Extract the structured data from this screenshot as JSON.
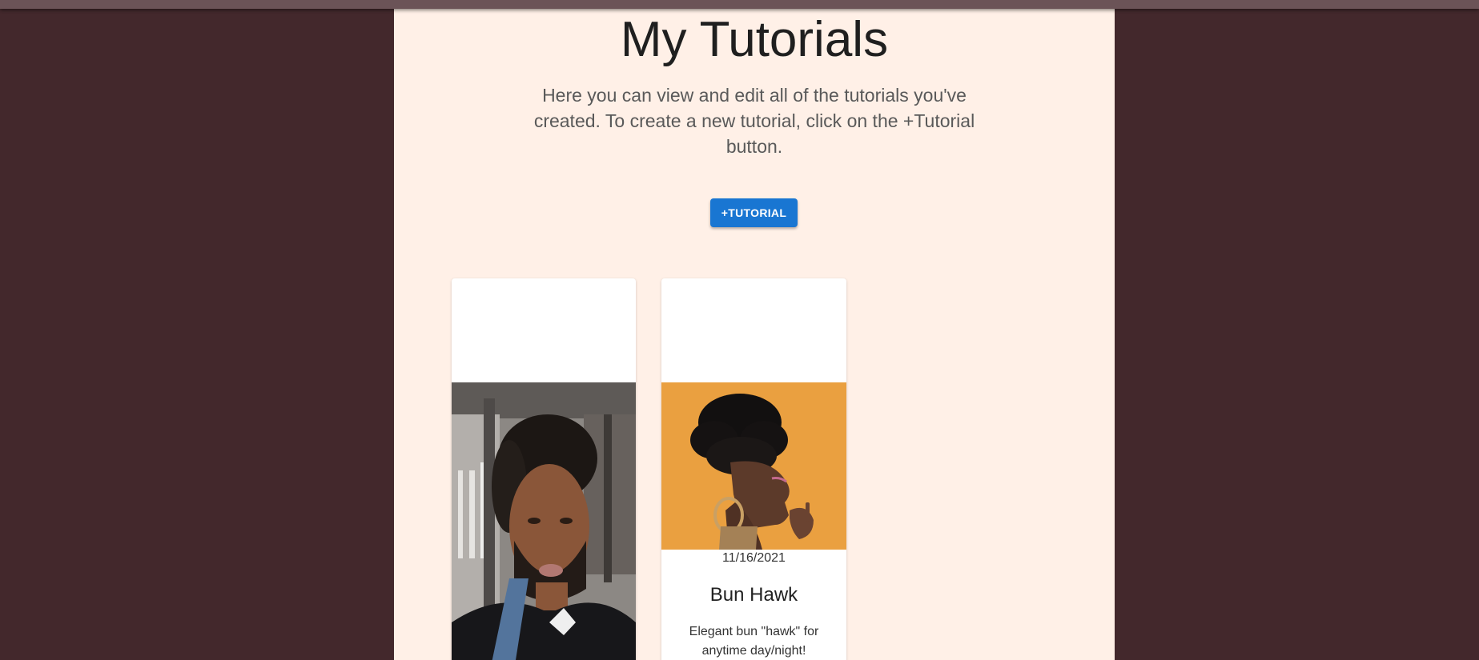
{
  "page": {
    "title": "My Tutorials",
    "description": "Here you can view and edit all of the tutorials you've created. To create a new tutorial, click on the +Tutorial button.",
    "add_button_label": "+TUTORIAL"
  },
  "colors": {
    "background": "#43282c",
    "content_background": "#fff0e7",
    "button": "#1976d2",
    "card_2_photo_background": "#eaa040"
  },
  "tutorials": [
    {
      "image": "photo of a man with twisted hairstyle"
    },
    {
      "image": "photo of a woman with a bun hawk hairstyle",
      "date": "11/16/2021",
      "title": "Bun Hawk",
      "description": "Elegant bun \"hawk\" for anytime day/night!"
    }
  ]
}
